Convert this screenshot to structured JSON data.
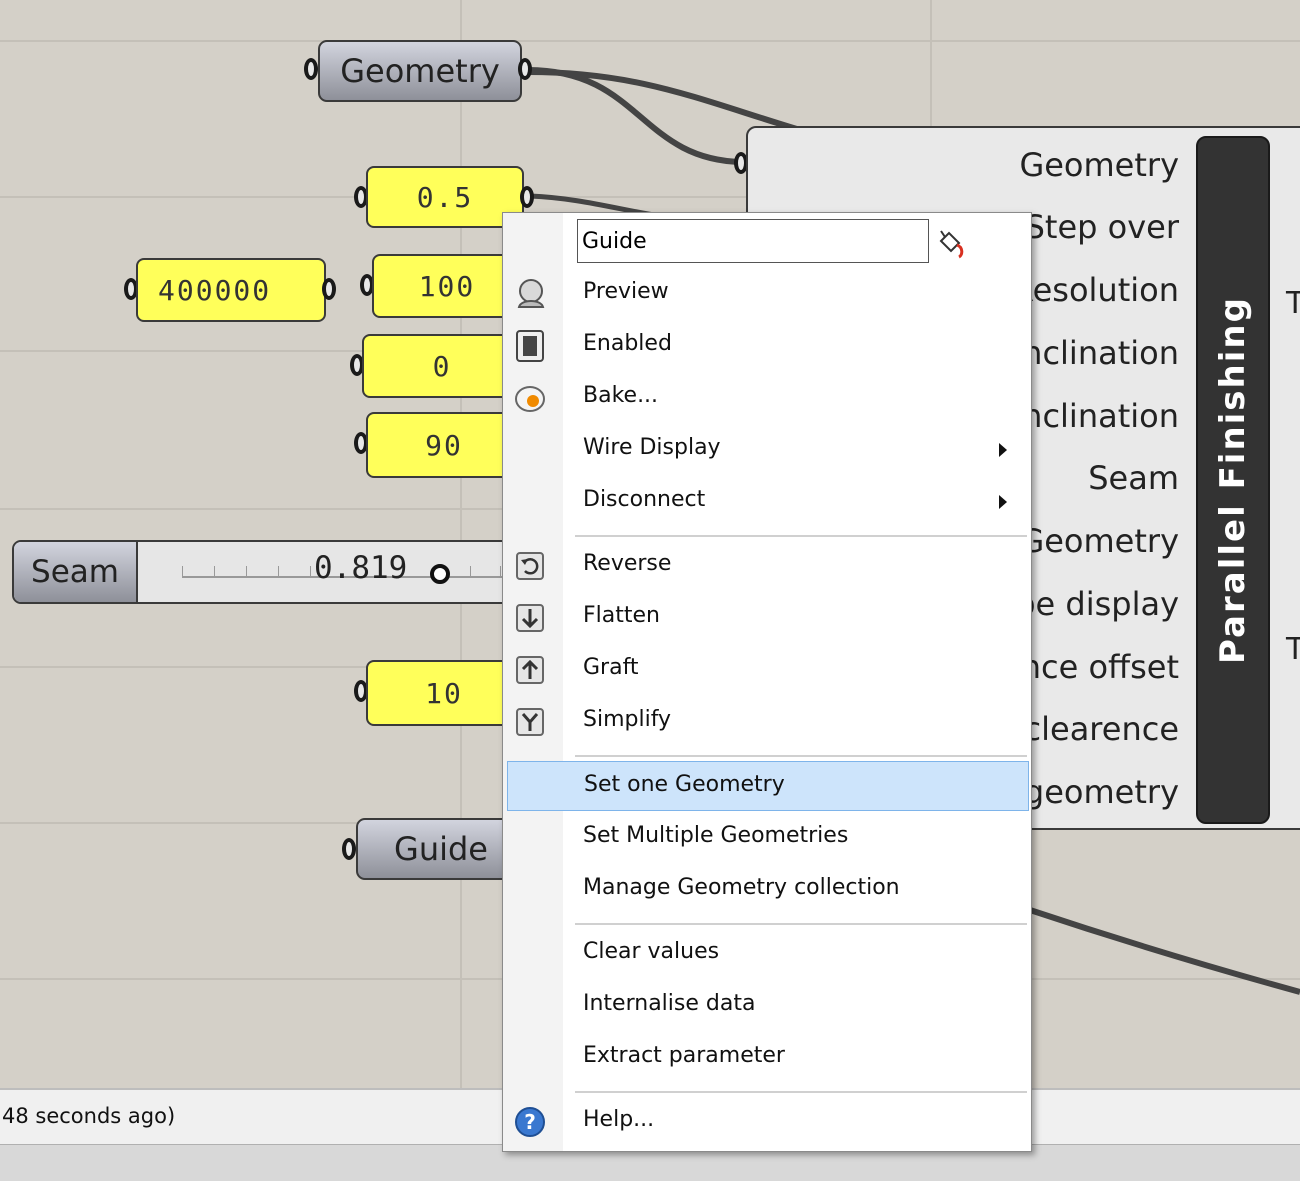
{
  "canvas": {
    "params": {
      "geometry": "Geometry",
      "guide": "Guide"
    },
    "number_sliders": {
      "v1": "0.5",
      "v2": "400000",
      "v3": "100",
      "v4": "0",
      "v5": "90",
      "v6": "10"
    },
    "slider": {
      "label": "Seam",
      "value": "0.819"
    },
    "component": {
      "nickname": "Parallel Finishing",
      "inputs": [
        "Geometry",
        "Step over",
        "Resolution",
        "nclination",
        "nclination",
        "Seam",
        "Geometry",
        "pe display",
        "nce offset",
        "clearence",
        "geometry"
      ],
      "outputs": [
        "T",
        "T"
      ]
    }
  },
  "context_menu": {
    "name_value": "Guide",
    "items": {
      "preview": "Preview",
      "enabled": "Enabled",
      "bake": "Bake...",
      "wire_display": "Wire Display",
      "disconnect": "Disconnect",
      "reverse": "Reverse",
      "flatten": "Flatten",
      "graft": "Graft",
      "simplify": "Simplify",
      "set_one": "Set one Geometry",
      "set_multiple": "Set Multiple Geometries",
      "manage": "Manage Geometry collection",
      "clear": "Clear values",
      "internalise": "Internalise data",
      "extract": "Extract parameter",
      "help": "Help..."
    },
    "icons": {
      "preview": "preview-icon",
      "enabled": "enabled-icon",
      "bake": "bake-icon",
      "reverse": "reverse-icon",
      "flatten": "flatten-icon",
      "graft": "graft-icon",
      "simplify": "simplify-icon",
      "help": "help-icon",
      "paint": "paint-bucket-icon"
    },
    "highlight_color": "#cde4fb"
  },
  "status": {
    "text": "48 seconds ago)"
  }
}
